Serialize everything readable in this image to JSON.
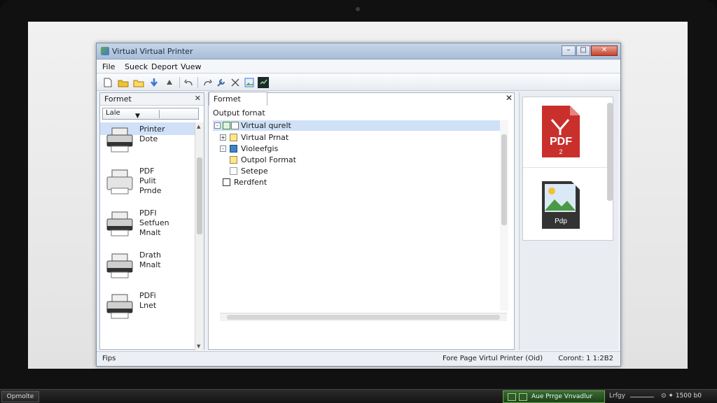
{
  "window": {
    "title": "Virtual Virtual Printer",
    "buttons": {
      "minimize": "–",
      "maximize": "□",
      "close": "✕"
    }
  },
  "menu": [
    "File",
    "Sueck",
    "Deport",
    "Vuew"
  ],
  "toolbar": {
    "icons": [
      "new-file-icon",
      "open-folder-icon",
      "open-folder-icon",
      "arrow-down-icon",
      "arrow-up-icon",
      "undo-icon",
      "redo-icon",
      "wrench-icon",
      "scissors-icon",
      "image-icon",
      "console-icon"
    ]
  },
  "left_panel": {
    "header": "Formet",
    "close": "✕",
    "combo": {
      "value": "Lale",
      "arrow": "▼"
    },
    "items": [
      {
        "lines": [
          "Printer",
          "Dote"
        ]
      },
      {
        "lines": [
          "PDF",
          "Pulit",
          "Prnde"
        ]
      },
      {
        "lines": [
          "PDFI",
          "Setfuen",
          "Mnalt"
        ]
      },
      {
        "lines": [
          "Drath",
          "Mnalt"
        ]
      },
      {
        "lines": [
          "PDFi",
          "Lnet"
        ]
      }
    ]
  },
  "mid_panel": {
    "tab": "Formet",
    "close": "✕",
    "subtitle": "Output fornat",
    "tree": [
      {
        "label": "Virtual qurelt",
        "toggle": "-",
        "icon": "g",
        "selected": true
      },
      {
        "label": "Virtual Prnat",
        "toggle": "+",
        "icon": "folder"
      },
      {
        "label": "Violeefgis",
        "toggle": "-",
        "icon": "blue"
      },
      {
        "label": "Outpol Format",
        "toggle": "",
        "icon": "folder"
      },
      {
        "label": "Setepe",
        "toggle": "",
        "icon": "blank"
      },
      {
        "label": "Rerdfent",
        "toggle": "",
        "icon": "doc"
      }
    ]
  },
  "right_panel": {
    "pdf_label": "PDF",
    "pdf_sub": "2",
    "img_label": "Pdp"
  },
  "statusbar": {
    "left": "Fips",
    "mid": "Fore Page Virtul Printer (Oid)",
    "right": "Coront: 1 1:2B2"
  },
  "taskbar": {
    "start": "Opmolte",
    "app": "Aue Prrge Vnvadlur",
    "tray": "Lrfgy",
    "time": "1500 b0",
    "tray_icons": "⊙ ✦"
  },
  "colors": {
    "accent": "#3c78d8",
    "pdf_red": "#c9302c",
    "selection": "#cfe0f7"
  }
}
